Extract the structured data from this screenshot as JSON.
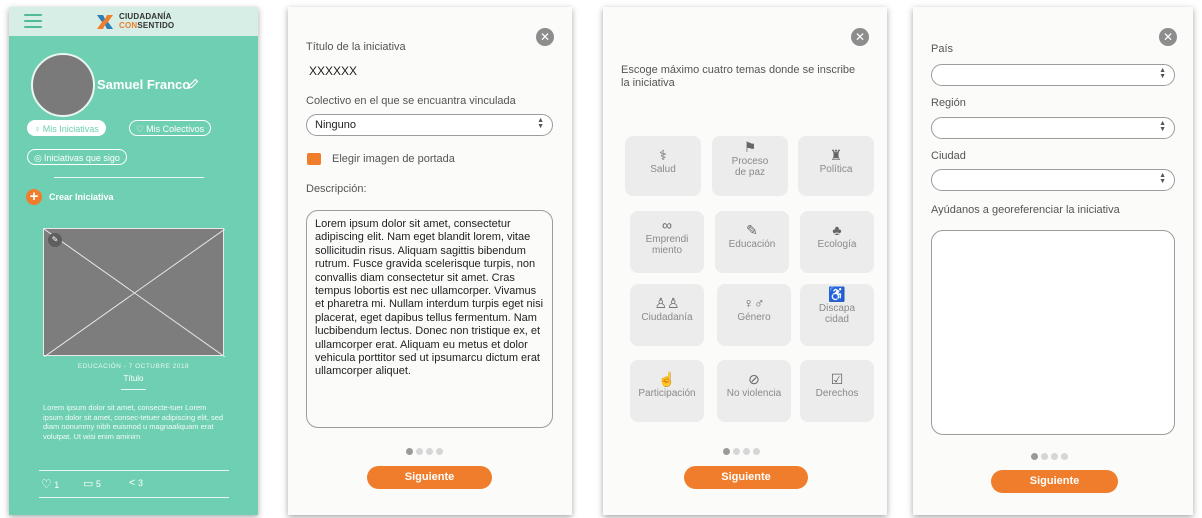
{
  "screen1": {
    "logo_line1": "CIUDADANÍA",
    "logo_line2_a": "CON",
    "logo_line2_b": "SENTIDO",
    "user_name": "Samuel Franco",
    "nav": {
      "mis_iniciativas": "Mis Iniciativas",
      "mis_colectivos": "Mis Colectivos",
      "iniciativas_que_sigo": "Iniciativas que sigo"
    },
    "crear_iniciativa": "Crear Iniciativa",
    "card": {
      "category_date": "EDUCACIÓN - 7 OCTUBRE 2018",
      "title": "Título",
      "description": "Lorem ipsum dolor sit amet, consecte-tuer Lorem ipsum dolor sit amet, consec-tetuer adipiscing elit, sed diam nonummy nibh euismod  u magnaaliquam erat volutpat. Ut wisi enim aminim",
      "likes": "1",
      "comments": "5",
      "shares": "3"
    },
    "colors": {
      "background": "#6fcfb2",
      "accent": "#ef7d2b"
    }
  },
  "screen2": {
    "titulo_label": "Título de la iniciativa",
    "titulo_value": "XXXXXX",
    "colectivo_label": "Colectivo en el que se encuantra vinculada",
    "colectivo_value": "Ninguno",
    "elegir_imagen": "Elegir imagen de portada",
    "descripcion_label": "Descripción:",
    "descripcion_text": "Lorem ipsum dolor sit amet, consectetur adipiscing elit. Nam eget blandit lorem, vitae sollicitudin risus. Aliquam sagittis bibendum rutrum. Fusce gravida scelerisque turpis, non convallis diam consectetur sit amet. Cras tempus lobortis est nec ullamcorper. Vivamus et pharetra mi. Nullam interdum turpis eget nisi placerat, eget dapibus tellus fermentum. Nam lucbibendum lectus. Donec non tristique ex, et ullamcorper erat. Aliquam eu metus et dolor vehicula porttitor sed ut ipsumarcu dictum erat ullamcorper aliquet.",
    "next_label": "Siguiente",
    "step": 1
  },
  "screen3": {
    "prompt": "Escoge máximo cuatro temas donde se inscribe la iniciativa",
    "topics": [
      {
        "label": "Salud",
        "icon": "doctor-icon"
      },
      {
        "label": "Proceso de paz",
        "icon": "flag-person-icon"
      },
      {
        "label": "Política",
        "icon": "group-podium-icon"
      },
      {
        "label": "Emprendi miento",
        "icon": "handshake-icon"
      },
      {
        "label": "Educación",
        "icon": "teacher-icon"
      },
      {
        "label": "Ecología",
        "icon": "tree-icon"
      },
      {
        "label": "Ciudadanía",
        "icon": "people-icon"
      },
      {
        "label": "Género",
        "icon": "couple-icon"
      },
      {
        "label": "Discapa cidad",
        "icon": "wheelchair-icon"
      },
      {
        "label": "Participación",
        "icon": "person-raised-hand-icon"
      },
      {
        "label": "No violencia",
        "icon": "no-fist-icon"
      },
      {
        "label": "Derechos",
        "icon": "document-check-icon"
      }
    ],
    "next_label": "Siguiente",
    "step": 1
  },
  "screen4": {
    "pais_label": "País",
    "region_label": "Región",
    "ciudad_label": "Ciudad",
    "geo_label": "Ayúdanos a georeferenciar la iniciativa",
    "next_label": "Siguiente",
    "step": 1
  }
}
